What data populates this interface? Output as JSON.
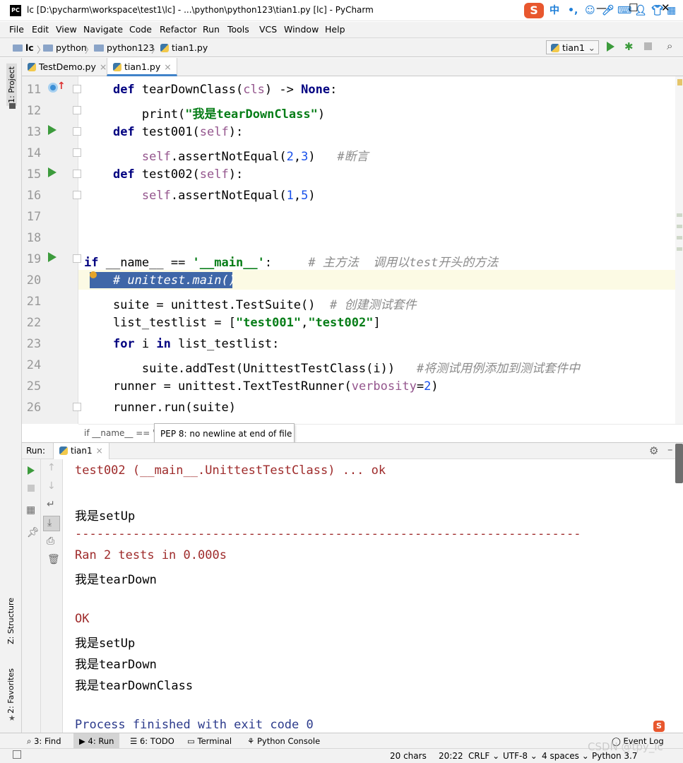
{
  "window": {
    "title": "lc [D:\\pycharm\\workspace\\test1\\lc] - ...\\python\\python123\\tian1.py [lc] - PyCharm",
    "logo": "PC"
  },
  "tray": {
    "ime": "S",
    "lang": "中",
    "sep": "•,"
  },
  "menu": [
    "File",
    "Edit",
    "View",
    "Navigate",
    "Code",
    "Refactor",
    "Run",
    "Tools",
    "VCS",
    "Window",
    "Help"
  ],
  "nav": {
    "crumbs": [
      "lc",
      "python",
      "python123",
      "tian1.py"
    ],
    "run_config": "tian1"
  },
  "left_strip": {
    "project": "1: Project",
    "structure": "Z: Structure",
    "favorites": "2: Favorites"
  },
  "tabs": [
    {
      "label": "TestDemo.py",
      "active": false
    },
    {
      "label": "tian1.py",
      "active": true
    }
  ],
  "editor": {
    "lines": [
      {
        "n": "11",
        "code": [
          {
            "t": "    "
          },
          {
            "t": "def ",
            "c": "kw"
          },
          {
            "t": "tearDownClass("
          },
          {
            "t": "cls",
            "c": "param"
          },
          {
            "t": ") -> "
          },
          {
            "t": "None",
            "c": "kw"
          },
          {
            "t": ":"
          }
        ]
      },
      {
        "n": "12",
        "code": [
          {
            "t": "        print("
          },
          {
            "t": "\"我是tearDownClass\"",
            "c": "str"
          },
          {
            "t": ")"
          }
        ]
      },
      {
        "n": "13",
        "code": [
          {
            "t": "    "
          },
          {
            "t": "def ",
            "c": "kw"
          },
          {
            "t": "test001("
          },
          {
            "t": "self",
            "c": "selfk"
          },
          {
            "t": "):"
          }
        ]
      },
      {
        "n": "14",
        "code": [
          {
            "t": "        "
          },
          {
            "t": "self",
            "c": "selfk"
          },
          {
            "t": ".assertNotEqual("
          },
          {
            "t": "2",
            "c": "num"
          },
          {
            "t": ","
          },
          {
            "t": "3",
            "c": "num"
          },
          {
            "t": ")   "
          },
          {
            "t": "#断言",
            "c": "cmt"
          }
        ]
      },
      {
        "n": "15",
        "code": [
          {
            "t": "    "
          },
          {
            "t": "def ",
            "c": "kw"
          },
          {
            "t": "test002("
          },
          {
            "t": "self",
            "c": "selfk"
          },
          {
            "t": "):"
          }
        ]
      },
      {
        "n": "16",
        "code": [
          {
            "t": "        "
          },
          {
            "t": "self",
            "c": "selfk"
          },
          {
            "t": ".assertNotEqual("
          },
          {
            "t": "1",
            "c": "num"
          },
          {
            "t": ","
          },
          {
            "t": "5",
            "c": "num"
          },
          {
            "t": ")"
          }
        ]
      },
      {
        "n": "17",
        "code": []
      },
      {
        "n": "18",
        "code": []
      },
      {
        "n": "19",
        "code": [
          {
            "t": "if ",
            "c": "kw"
          },
          {
            "t": "__name__ == "
          },
          {
            "t": "'__main__'",
            "c": "str"
          },
          {
            "t": ":     "
          },
          {
            "t": "# 主方法  调用以test开头的方法",
            "c": "cmt"
          }
        ]
      },
      {
        "n": "20",
        "code": [
          {
            "t": "    "
          },
          {
            "t": "# unittest.main()",
            "c": "cmtsel"
          }
        ]
      },
      {
        "n": "21",
        "code": [
          {
            "t": "    suite = unittest.TestSuite()  "
          },
          {
            "t": "# 创建测试套件",
            "c": "cmt"
          }
        ]
      },
      {
        "n": "22",
        "code": [
          {
            "t": "    list_testlist = ["
          },
          {
            "t": "\"test001\"",
            "c": "str"
          },
          {
            "t": ","
          },
          {
            "t": "\"test002\"",
            "c": "str"
          },
          {
            "t": "]"
          }
        ]
      },
      {
        "n": "23",
        "code": [
          {
            "t": "    "
          },
          {
            "t": "for ",
            "c": "kw"
          },
          {
            "t": "i "
          },
          {
            "t": "in ",
            "c": "kw"
          },
          {
            "t": "list_testlist:"
          }
        ]
      },
      {
        "n": "24",
        "code": [
          {
            "t": "        suite.addTest(UnittestTestClass(i))   "
          },
          {
            "t": "#将测试用例添加到测试套件中",
            "c": "cmt"
          }
        ]
      },
      {
        "n": "25",
        "code": [
          {
            "t": "    runner = unittest.TextTestRunner("
          },
          {
            "t": "verbosity",
            "c": "param"
          },
          {
            "t": "="
          },
          {
            "t": "2",
            "c": "num"
          },
          {
            "t": ")"
          }
        ]
      },
      {
        "n": "26",
        "code": [
          {
            "t": "    runner.run(suite)"
          }
        ]
      }
    ],
    "breadcrumb": "if __name__ == '",
    "tooltip": "PEP 8: no newline at end of file"
  },
  "run": {
    "label": "Run:",
    "tab": "tian1",
    "output": [
      {
        "t": "test002 (__main__.UnittestTestClass) ... ok",
        "c": "red"
      },
      {
        "t": "",
        "c": "blk"
      },
      {
        "t": "我是setUp",
        "c": "blk"
      },
      {
        "t": "----------------------------------------------------------------------",
        "c": "red"
      },
      {
        "t": "Ran 2 tests in 0.000s",
        "c": "red"
      },
      {
        "t": "我是tearDown",
        "c": "blk"
      },
      {
        "t": "",
        "c": "blk"
      },
      {
        "t": "OK",
        "c": "red"
      },
      {
        "t": "我是setUp",
        "c": "blk"
      },
      {
        "t": "我是tearDown",
        "c": "blk"
      },
      {
        "t": "我是tearDownClass",
        "c": "blk"
      },
      {
        "t": "",
        "c": "blk"
      },
      {
        "t": "Process finished with exit code 0",
        "c": "blu"
      }
    ]
  },
  "bottom_tabs": [
    "3: Find",
    "4: Run",
    "6: TODO",
    "Terminal",
    "Python Console"
  ],
  "event_log": "Event Log",
  "status": {
    "chars": "20 chars",
    "pos": "20:22",
    "eol": "CRLF",
    "enc": "UTF-8",
    "indent": "4 spaces",
    "interp": "Python 3.7"
  },
  "watermark": "CSDN @tpy_lc"
}
